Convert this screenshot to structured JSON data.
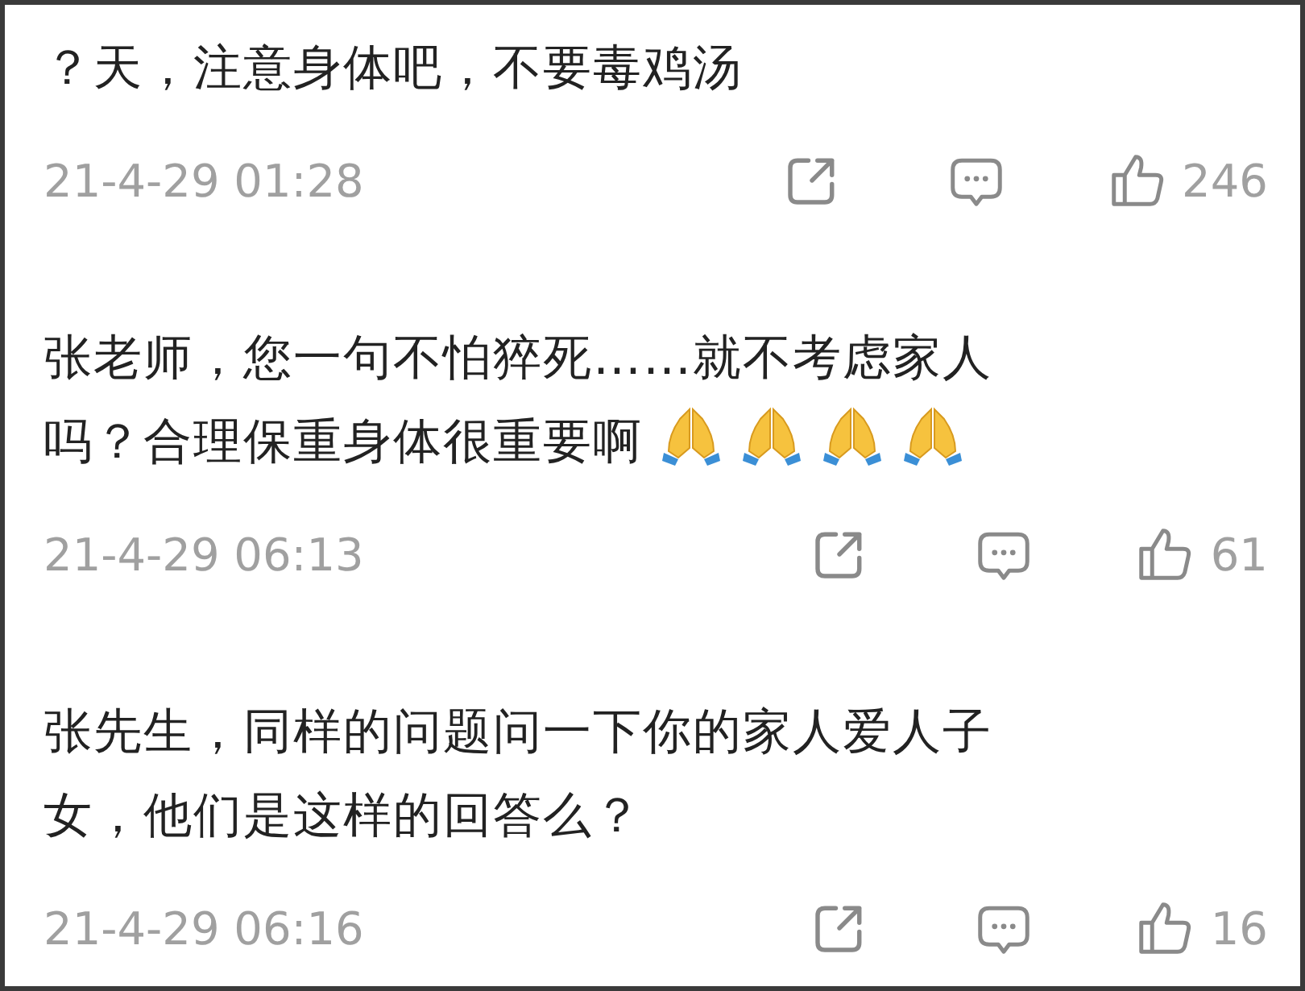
{
  "comments": [
    {
      "lines": [
        "？天，注意身体吧，不要毒鸡汤"
      ],
      "time": "21-4-29 01:28",
      "likes": "246"
    },
    {
      "lines": [
        "张老师，您一句不怕猝死……就不考虑家人",
        "吗？合理保重身体很重要啊"
      ],
      "reactions": [
        {
          "kind": "pray"
        },
        {
          "kind": "pray"
        },
        {
          "kind": "pray"
        },
        {
          "kind": "pray"
        }
      ],
      "time": "21-4-29 06:13",
      "likes": "61"
    },
    {
      "lines": [
        "张先生，同样的问题问一下你的家人爱人子",
        "女，他们是这样的回答么？"
      ],
      "time": "21-4-29 06:16",
      "likes": "16"
    }
  ]
}
